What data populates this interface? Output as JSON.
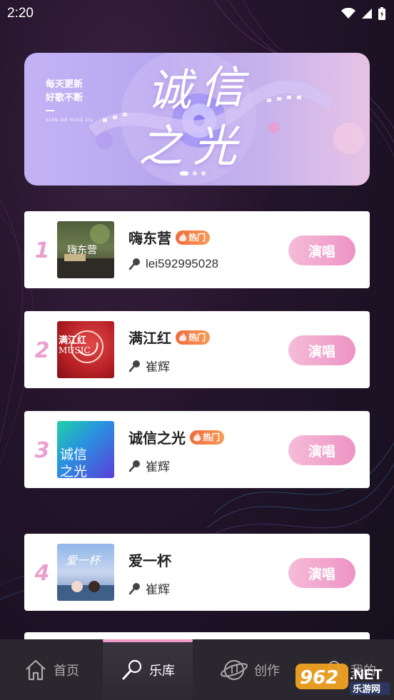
{
  "status_bar": {
    "time": "2:20"
  },
  "banner": {
    "tagline_line1": "每天更新",
    "tagline_line2": "好歌不断",
    "tagline_small": "XIAN GE NIAO JIU",
    "title_char1": "诚",
    "title_char2": "信",
    "title_char3": "之",
    "title_char4": "光"
  },
  "songs": [
    {
      "rank": "1",
      "title": "嗨东营",
      "hot": "热门",
      "singer": "lei592995028",
      "button": "演唱",
      "cover_text": "嗨东营"
    },
    {
      "rank": "2",
      "title": "满江红",
      "hot": "热门",
      "singer": "崔辉",
      "button": "演唱",
      "cover_text": "满江红",
      "cover_sub": "MUSIC"
    },
    {
      "rank": "3",
      "title": "诚信之光",
      "hot": "热门",
      "singer": "崔辉",
      "button": "演唱",
      "cover_text1": "诚信",
      "cover_text2": "之光"
    },
    {
      "rank": "4",
      "title": "爱一杯",
      "singer": "崔辉",
      "button": "演唱",
      "cover_text": "爱一杯"
    }
  ],
  "tabbar": {
    "items": [
      {
        "label": "首页",
        "icon": "home-icon"
      },
      {
        "label": "乐库",
        "icon": "microphone-icon"
      },
      {
        "label": "创作",
        "icon": "music-planet-icon"
      },
      {
        "label": "我的",
        "icon": "user-icon"
      }
    ],
    "active_index": 1
  },
  "watermark": {
    "text_top": "962",
    "text_tld": ".NET",
    "text_bottom": "乐游网"
  },
  "colors": {
    "accent_pink": "#ee93c4",
    "rank_pink": "#e9a0cf",
    "hot_orange": "#f06a3c"
  }
}
